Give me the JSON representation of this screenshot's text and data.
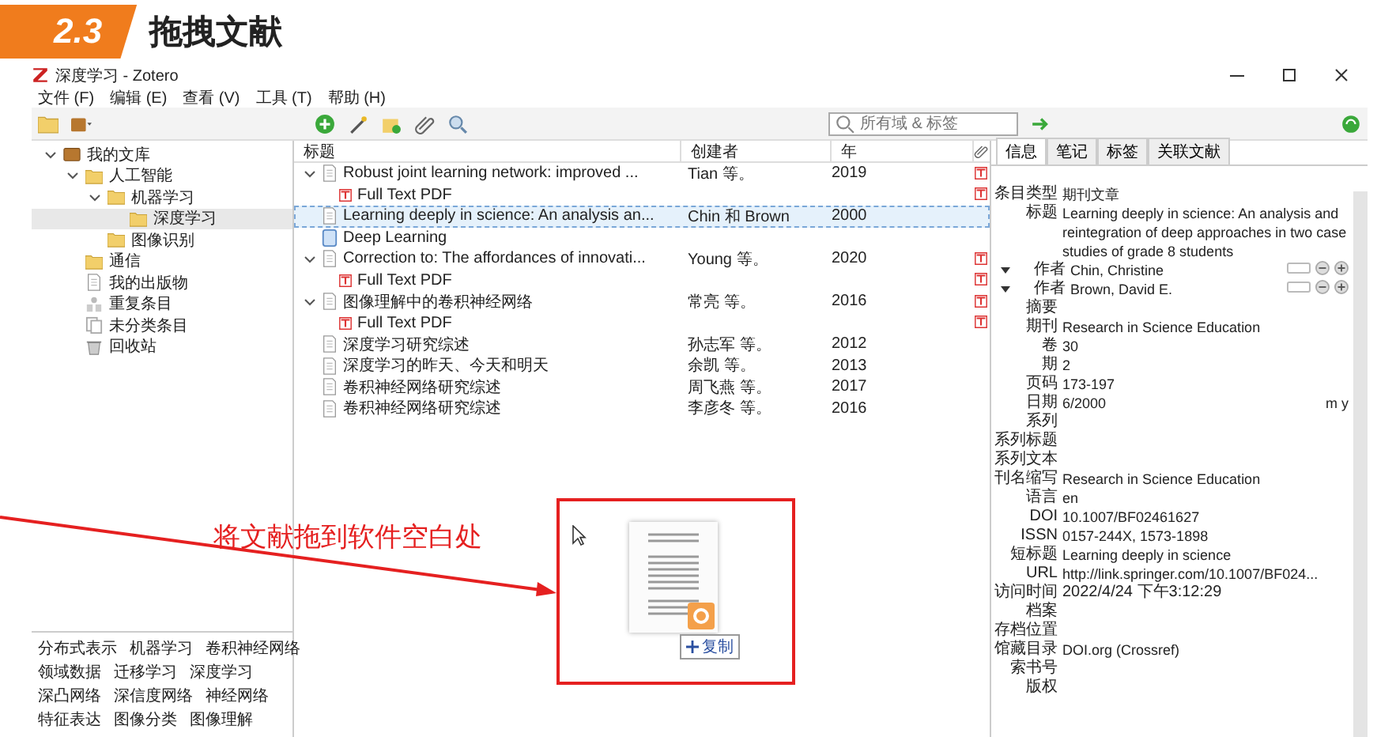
{
  "slide": {
    "number": "2.3",
    "title": "拖拽文献"
  },
  "window": {
    "title": "深度学习 - Zotero"
  },
  "menu": [
    "文件 (F)",
    "编辑 (E)",
    "查看 (V)",
    "工具 (T)",
    "帮助 (H)"
  ],
  "search": {
    "placeholder": "所有域 & 标签"
  },
  "collections": [
    {
      "label": "我的文库",
      "kind": "library",
      "expanded": true,
      "selected": false,
      "children": [
        {
          "label": "人工智能",
          "kind": "folder",
          "expanded": true,
          "selected": false,
          "children": [
            {
              "label": "机器学习",
              "kind": "folder",
              "expanded": true,
              "selected": false,
              "children": [
                {
                  "label": "深度学习",
                  "kind": "folder",
                  "selected": true
                }
              ]
            },
            {
              "label": "图像识别",
              "kind": "folder",
              "selected": false
            }
          ]
        },
        {
          "label": "通信",
          "kind": "folder",
          "selected": false
        },
        {
          "label": "我的出版物",
          "kind": "publications",
          "selected": false
        },
        {
          "label": "重复条目",
          "kind": "duplicates",
          "selected": false
        },
        {
          "label": "未分类条目",
          "kind": "unfiled",
          "selected": false
        },
        {
          "label": "回收站",
          "kind": "trash",
          "selected": false
        }
      ]
    }
  ],
  "tags": [
    [
      "分布式表示",
      "机器学习",
      "卷积神经网络"
    ],
    [
      "领域数据",
      "迁移学习",
      "深度学习"
    ],
    [
      "深凸网络",
      "深信度网络",
      "神经网络"
    ],
    [
      "特征表达",
      "图像分类",
      "图像理解"
    ]
  ],
  "items": {
    "columns": [
      "标题",
      "创建者",
      "年"
    ],
    "rows": [
      {
        "kind": "article",
        "title": "Robust joint learning network: improved ...",
        "creator": "Tian 等。",
        "year": "2019",
        "attachment": true,
        "selected": false,
        "expanded": true,
        "children": [
          {
            "kind": "pdf",
            "title": "Full Text PDF",
            "attachment": true,
            "selected": false
          }
        ]
      },
      {
        "kind": "article",
        "title": "Learning deeply in science: An analysis an...",
        "creator": "Chin 和 Brown",
        "year": "2000",
        "attachment": false,
        "selected": true
      },
      {
        "kind": "note",
        "title": "Deep Learning",
        "attachment": false,
        "selected": false
      },
      {
        "kind": "article",
        "title": "Correction to: The affordances of innovati...",
        "creator": "Young 等。",
        "year": "2020",
        "attachment": true,
        "selected": false,
        "expanded": true,
        "children": [
          {
            "kind": "pdf",
            "title": "Full Text PDF",
            "attachment": true,
            "selected": false
          }
        ]
      },
      {
        "kind": "article",
        "title": "图像理解中的卷积神经网络",
        "creator": "常亮 等。",
        "year": "2016",
        "attachment": true,
        "selected": false,
        "expanded": true,
        "children": [
          {
            "kind": "pdf",
            "title": "Full Text PDF",
            "attachment": true,
            "selected": false
          }
        ]
      },
      {
        "kind": "article",
        "title": "深度学习研究综述",
        "creator": "孙志军 等。",
        "year": "2012",
        "attachment": false,
        "selected": false
      },
      {
        "kind": "article",
        "title": "深度学习的昨天、今天和明天",
        "creator": "余凯 等。",
        "year": "2013",
        "attachment": false,
        "selected": false
      },
      {
        "kind": "article",
        "title": "卷积神经网络研究综述",
        "creator": "周飞燕 等。",
        "year": "2017",
        "attachment": false,
        "selected": false
      },
      {
        "kind": "article",
        "title": "卷积神经网络研究综述",
        "creator": "李彦冬 等。",
        "year": "2016",
        "attachment": false,
        "selected": false
      }
    ]
  },
  "info_tabs": [
    {
      "label": "信息",
      "selected": true
    },
    {
      "label": "笔记",
      "selected": false
    },
    {
      "label": "标签",
      "selected": false
    },
    {
      "label": "关联文献",
      "selected": false
    }
  ],
  "fields": [
    {
      "kind": "text",
      "label": "条目类型",
      "value": "期刊文章"
    },
    {
      "kind": "text",
      "label": "标题",
      "value": "Learning deeply in science: An analysis and reintegration of deep approaches in two case studies of grade 8 students"
    },
    {
      "kind": "creator",
      "label": "作者",
      "value": "Chin, Christine"
    },
    {
      "kind": "creator",
      "label": "作者",
      "value": "Brown, David E."
    },
    {
      "kind": "text",
      "label": "摘要"
    },
    {
      "kind": "text",
      "label": "期刊",
      "value": "Research in Science Education"
    },
    {
      "kind": "text",
      "label": "卷",
      "value": "30"
    },
    {
      "kind": "text",
      "label": "期",
      "value": "2"
    },
    {
      "kind": "text",
      "label": "页码",
      "value": "173-197"
    },
    {
      "kind": "date",
      "label": "日期",
      "value": "6/2000",
      "suffix": "m y"
    },
    {
      "kind": "text",
      "label": "系列"
    },
    {
      "kind": "text",
      "label": "系列标题"
    },
    {
      "kind": "text",
      "label": "系列文本"
    },
    {
      "kind": "text",
      "label": "刊名缩写",
      "value": "Research in Science Education"
    },
    {
      "kind": "text",
      "label": "语言",
      "value": "en"
    },
    {
      "kind": "text",
      "label": "DOI",
      "value": "10.1007/BF02461627"
    },
    {
      "kind": "text",
      "label": "ISSN",
      "value": "0157-244X, 1573-1898"
    },
    {
      "kind": "text",
      "label": "短标题",
      "value": "Learning deeply in science"
    },
    {
      "kind": "text",
      "label": "URL",
      "value": "http://link.springer.com/10.1007/BF024..."
    },
    {
      "kind": "datetime",
      "label": "访问时间",
      "value": "2022/4/24 下午3:12:29"
    },
    {
      "kind": "text",
      "label": "档案"
    },
    {
      "kind": "text",
      "label": "存档位置"
    },
    {
      "kind": "text",
      "label": "馆藏目录",
      "value": "DOI.org (Crossref)"
    },
    {
      "kind": "text",
      "label": "索书号"
    },
    {
      "kind": "text",
      "label": "版权"
    }
  ],
  "annotation": {
    "text": "将文献拖到软件空白处",
    "drag_label": "复制"
  }
}
